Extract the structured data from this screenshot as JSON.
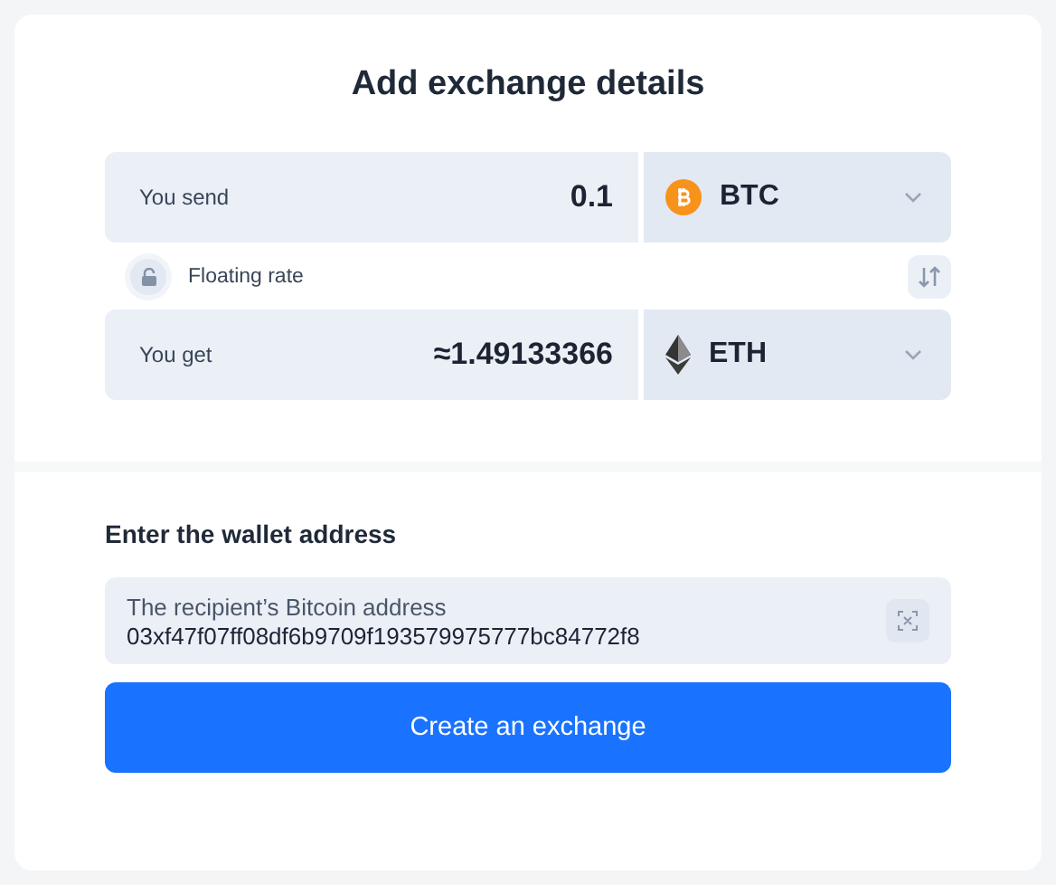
{
  "title": "Add exchange details",
  "rows": [
    {
      "label": "You send",
      "amount": "0.1",
      "currency": {
        "code": "BTC",
        "kind": "btc"
      }
    },
    {
      "label": "You get",
      "amount": "≈1.49133366",
      "currency": {
        "code": "ETH",
        "kind": "eth"
      }
    }
  ],
  "rate": {
    "label": "Floating rate",
    "locked": false
  },
  "wallet": {
    "heading": "Enter the wallet address",
    "placeholder": "The recipient’s Bitcoin address",
    "value": "03xf47f07ff08df6b9709f193579975777bc84772f8"
  },
  "button": "Create an exchange"
}
